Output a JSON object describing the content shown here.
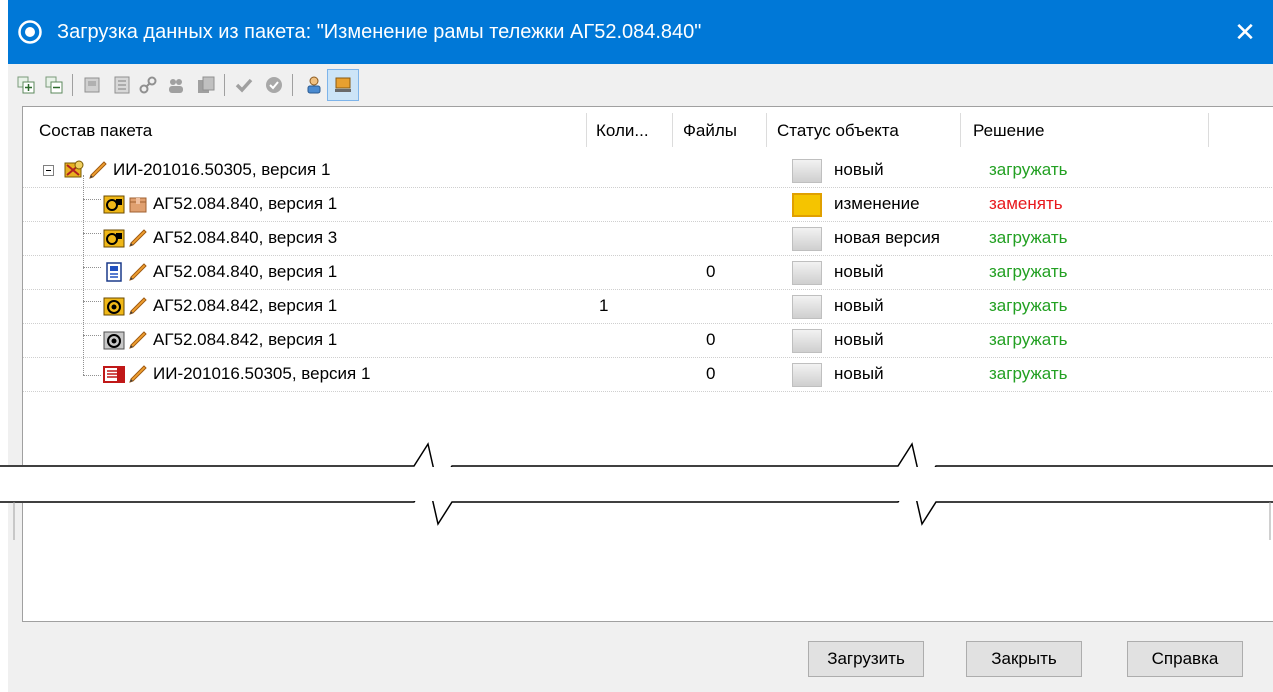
{
  "window": {
    "title": "Загрузка данных из пакета: \"Изменение рамы тележки АГ52.084.840\"",
    "close_glyph": "✕"
  },
  "toolbar": {
    "icons": [
      "expand-all-icon",
      "collapse-all-icon",
      "document-icon",
      "list-icon",
      "link-icon",
      "group-icon",
      "copy-icon",
      "check-icon",
      "cancel-icon",
      "user-icon",
      "monitor-icon"
    ]
  },
  "table": {
    "columns": [
      "Состав пакета",
      "Коли...",
      "Файлы",
      "Статус объекта",
      "Решение"
    ],
    "rows": [
      {
        "name": "ИИ-201016.50305, версия 1",
        "qty": "",
        "files": "",
        "status": "новый",
        "decision": "загружать",
        "decision_color": "#22a022",
        "status_color": "gray",
        "icon": "package-icon",
        "edit": "pencil-icon"
      },
      {
        "name": "АГ52.084.840, версия 1",
        "qty": "",
        "files": "",
        "status": "изменение",
        "decision": "заменять",
        "decision_color": "#e8181d",
        "status_color": "yellow",
        "icon": "assembly-icon",
        "edit": "box-icon"
      },
      {
        "name": "АГ52.084.840, версия 3",
        "qty": "",
        "files": "",
        "status": "новая версия",
        "decision": "загружать",
        "decision_color": "#22a022",
        "status_color": "gray",
        "icon": "assembly-icon",
        "edit": "pencil-icon"
      },
      {
        "name": "АГ52.084.840, версия 1",
        "qty": "",
        "files": "0",
        "status": "новый",
        "decision": "загружать",
        "decision_color": "#22a022",
        "status_color": "gray",
        "icon": "drawing-icon",
        "edit": "pencil-icon"
      },
      {
        "name": "АГ52.084.842, версия 1",
        "qty": "1",
        "files": "",
        "status": "новый",
        "decision": "загружать",
        "decision_color": "#22a022",
        "status_color": "gray",
        "icon": "part-icon",
        "edit": "pencil-icon"
      },
      {
        "name": "АГ52.084.842, версия 1",
        "qty": "",
        "files": "0",
        "status": "новый",
        "decision": "загружать",
        "decision_color": "#22a022",
        "status_color": "gray",
        "icon": "part-gray-icon",
        "edit": "pencil-icon"
      },
      {
        "name": "ИИ-201016.50305, версия 1",
        "qty": "",
        "files": "0",
        "status": "новый",
        "decision": "загружать",
        "decision_color": "#22a022",
        "status_color": "gray",
        "icon": "notice-icon",
        "edit": "pencil-icon"
      }
    ]
  },
  "buttons": {
    "load": "Загрузить",
    "close": "Закрыть",
    "help": "Справка"
  },
  "colors": {
    "titlebar": "#0078d7",
    "decision_load": "#22a022",
    "decision_replace": "#e8181d",
    "status_changed": "#f5c400"
  }
}
